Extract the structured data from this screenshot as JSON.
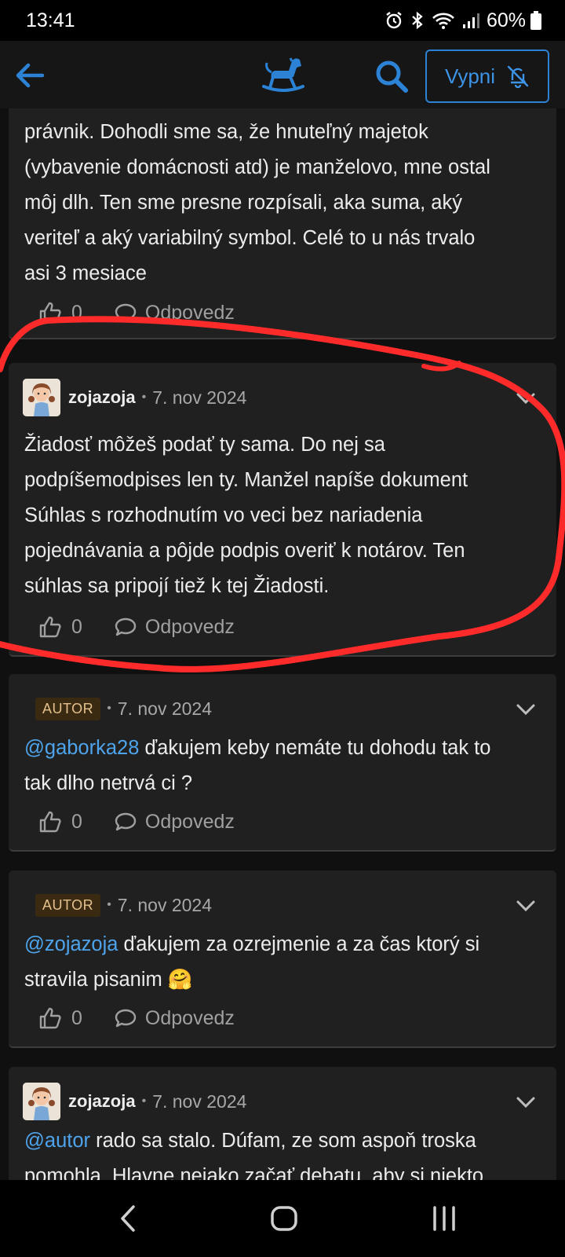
{
  "status_bar": {
    "time": "13:41",
    "battery": "60%",
    "icons": [
      "alarm-icon",
      "bluetooth-icon",
      "wifi-icon",
      "signal-icon",
      "battery-icon"
    ]
  },
  "app_bar": {
    "back_icon": "arrow-left-icon",
    "logo_icon": "rocking-horse-icon",
    "search_icon": "search-icon",
    "mute_label": "Vypni",
    "mute_icon": "bell-off-icon"
  },
  "colors": {
    "accent": "#2c83d6",
    "annotation": "#ff2b2b",
    "mention": "#4ea4ec",
    "author_badge": "#e4c08c"
  },
  "posts": [
    {
      "partial": true,
      "lines": [
        "právnik. Dohodli sme sa, že hnuteľný majetok",
        "(vybavenie domácnosti atd) je manželovo, mne ostal",
        "môj dlh. Ten sme presne rozpísali, aka suma, aký",
        "veriteľ a aký variabilný symbol. Celé to u nás trvalo",
        "asi 3 mesiace"
      ],
      "likes": "0",
      "reply_label": "Odpovedz"
    },
    {
      "username": "zojazoja",
      "date": "7. nov 2024",
      "lines": [
        "Žiadosť môžeš podať ty sama. Do nej sa",
        "podpíšemodpises len ty. Manžel napíše dokument",
        "Súhlas s rozhodnutím vo veci bez nariadenia",
        "pojednávania a pôjde podpis overiť k notárov. Ten",
        "súhlas sa pripojí tiež k tej Žiadosti."
      ],
      "likes": "0",
      "reply_label": "Odpovedz"
    },
    {
      "badge": "AUTOR",
      "date": "7. nov 2024",
      "mention": "@gaborka28",
      "text_after_mention": " ďakujem keby nemáte tu dohodu tak to",
      "line2": "tak dlho netrvá ci ?",
      "likes": "0",
      "reply_label": "Odpovedz"
    },
    {
      "badge": "AUTOR",
      "date": "7. nov 2024",
      "mention": "@zojazoja",
      "text_after_mention": " ďakujem za ozrejmenie a za čas ktorý si",
      "line2": "stravila pisanim 🤗",
      "likes": "0",
      "reply_label": "Odpovedz"
    },
    {
      "username": "zojazoja",
      "date": "7. nov 2024",
      "mention": "@autor",
      "text_after_mention": " rado sa stalo. Dúfam, ze som aspoň troska",
      "line2": "pomohla. Hlavne nejako začať debatu, aby si niekto"
    }
  ],
  "nav_bar": {
    "icons": [
      "back-nav-icon",
      "home-nav-icon",
      "recents-nav-icon"
    ]
  }
}
